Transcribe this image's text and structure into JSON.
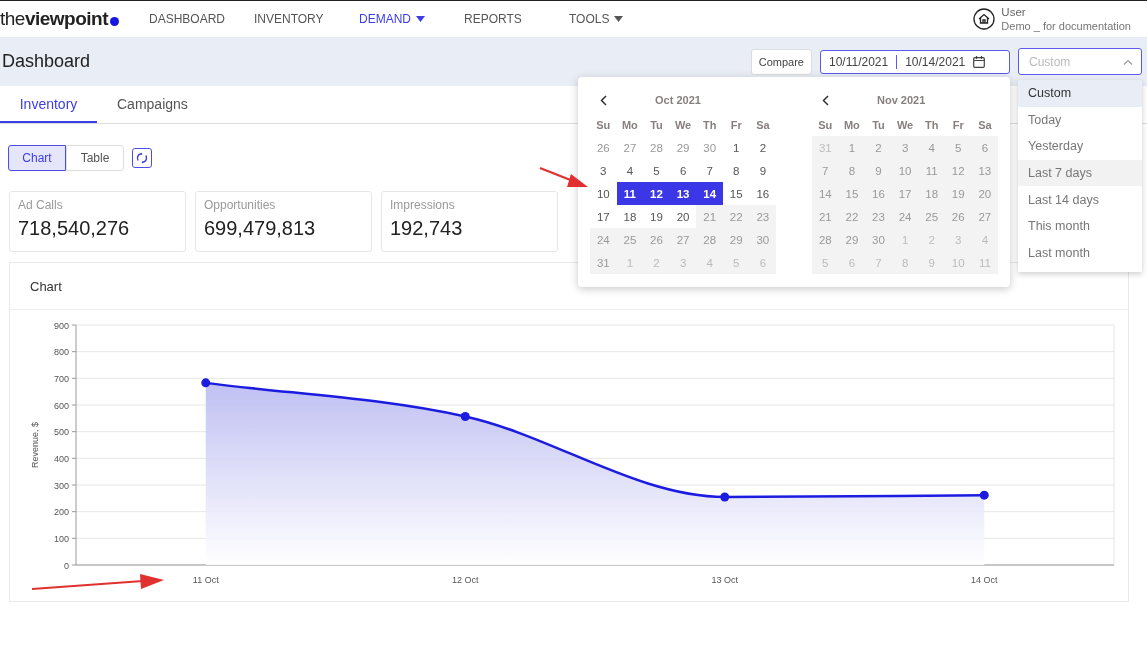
{
  "nav": {
    "logo": "the**viewpoint**",
    "items": [
      {
        "label": "DASHBOARD",
        "selected": false,
        "has_menu": false
      },
      {
        "label": "INVENTORY",
        "selected": false,
        "has_menu": false
      },
      {
        "label": "DEMAND",
        "selected": true,
        "has_menu": true
      },
      {
        "label": "REPORTS",
        "selected": false,
        "has_menu": false
      },
      {
        "label": "TOOLS",
        "selected": false,
        "has_menu": true
      }
    ],
    "user": {
      "name": "User",
      "account": "Demo _ for documentation"
    }
  },
  "header": {
    "title": "Dashboard",
    "compare": "Compare",
    "date_from": "10/11/2021",
    "date_to": "10/14/2021",
    "range_select": {
      "placeholder": "Custom",
      "expanded": true
    }
  },
  "tabs": [
    {
      "label": "Inventory",
      "selected": true
    },
    {
      "label": "Campaigns",
      "selected": false
    }
  ],
  "view_toggle": [
    {
      "label": "Chart",
      "selected": true
    },
    {
      "label": "Table",
      "selected": false
    }
  ],
  "stats": [
    {
      "label": "Ad Calls",
      "value": "718,540,276"
    },
    {
      "label": "Opportunities",
      "value": "699,479,813"
    },
    {
      "label": "Impressions",
      "value": "192,743"
    }
  ],
  "chart_card": {
    "title": "Chart",
    "chart_data": {
      "type": "area",
      "ylabel": "Revenue, $",
      "categories": [
        "11 Oct",
        "12 Oct",
        "13 Oct",
        "14 Oct"
      ],
      "series": [
        {
          "color": "#1c1ce0",
          "values": [
            683,
            557,
            255,
            262
          ]
        }
      ],
      "grid": true,
      "ylim": [
        0,
        900
      ],
      "yticks": [
        0,
        100,
        200,
        300,
        400,
        500,
        600,
        700,
        800,
        900
      ]
    }
  },
  "calendar": {
    "months": [
      {
        "title": "Oct 2021",
        "weekdays": [
          "Su",
          "Mo",
          "Tu",
          "We",
          "Th",
          "Fr",
          "Sa"
        ],
        "weeks": [
          [
            {
              "day": "26",
              "outside": true,
              "disabled": false,
              "selected": false
            },
            {
              "day": "27",
              "outside": true,
              "disabled": false,
              "selected": false
            },
            {
              "day": "28",
              "outside": true,
              "disabled": false,
              "selected": false
            },
            {
              "day": "29",
              "outside": true,
              "disabled": false,
              "selected": false
            },
            {
              "day": "30",
              "outside": true,
              "disabled": false,
              "selected": false
            },
            {
              "day": "1",
              "outside": false,
              "disabled": false,
              "selected": false
            },
            {
              "day": "2",
              "outside": false,
              "disabled": false,
              "selected": false
            }
          ],
          [
            {
              "day": "3",
              "outside": false,
              "disabled": false,
              "selected": false
            },
            {
              "day": "4",
              "outside": false,
              "disabled": false,
              "selected": false
            },
            {
              "day": "5",
              "outside": false,
              "disabled": false,
              "selected": false
            },
            {
              "day": "6",
              "outside": false,
              "disabled": false,
              "selected": false
            },
            {
              "day": "7",
              "outside": false,
              "disabled": false,
              "selected": false
            },
            {
              "day": "8",
              "outside": false,
              "disabled": false,
              "selected": false
            },
            {
              "day": "9",
              "outside": false,
              "disabled": false,
              "selected": false
            }
          ],
          [
            {
              "day": "10",
              "outside": false,
              "disabled": false,
              "selected": false
            },
            {
              "day": "11",
              "outside": false,
              "disabled": false,
              "selected": true
            },
            {
              "day": "12",
              "outside": false,
              "disabled": false,
              "selected": true
            },
            {
              "day": "13",
              "outside": false,
              "disabled": false,
              "selected": true
            },
            {
              "day": "14",
              "outside": false,
              "disabled": false,
              "selected": true
            },
            {
              "day": "15",
              "outside": false,
              "disabled": false,
              "selected": false
            },
            {
              "day": "16",
              "outside": false,
              "disabled": false,
              "selected": false
            }
          ],
          [
            {
              "day": "17",
              "outside": false,
              "disabled": false,
              "selected": false
            },
            {
              "day": "18",
              "outside": false,
              "disabled": false,
              "selected": false
            },
            {
              "day": "19",
              "outside": false,
              "disabled": false,
              "selected": false
            },
            {
              "day": "20",
              "outside": false,
              "disabled": false,
              "selected": false
            },
            {
              "day": "21",
              "outside": false,
              "disabled": true,
              "selected": false
            },
            {
              "day": "22",
              "outside": false,
              "disabled": true,
              "selected": false
            },
            {
              "day": "23",
              "outside": false,
              "disabled": true,
              "selected": false
            }
          ],
          [
            {
              "day": "24",
              "outside": false,
              "disabled": true,
              "selected": false
            },
            {
              "day": "25",
              "outside": false,
              "disabled": true,
              "selected": false
            },
            {
              "day": "26",
              "outside": false,
              "disabled": true,
              "selected": false
            },
            {
              "day": "27",
              "outside": false,
              "disabled": true,
              "selected": false
            },
            {
              "day": "28",
              "outside": false,
              "disabled": true,
              "selected": false
            },
            {
              "day": "29",
              "outside": false,
              "disabled": true,
              "selected": false
            },
            {
              "day": "30",
              "outside": false,
              "disabled": true,
              "selected": false
            }
          ],
          [
            {
              "day": "31",
              "outside": false,
              "disabled": true,
              "selected": false
            },
            {
              "day": "1",
              "outside": true,
              "disabled": true,
              "selected": false
            },
            {
              "day": "2",
              "outside": true,
              "disabled": true,
              "selected": false
            },
            {
              "day": "3",
              "outside": true,
              "disabled": true,
              "selected": false
            },
            {
              "day": "4",
              "outside": true,
              "disabled": true,
              "selected": false
            },
            {
              "day": "5",
              "outside": true,
              "disabled": true,
              "selected": false
            },
            {
              "day": "6",
              "outside": true,
              "disabled": true,
              "selected": false
            }
          ]
        ]
      },
      {
        "title": "Nov 2021",
        "weekdays": [
          "Su",
          "Mo",
          "Tu",
          "We",
          "Th",
          "Fr",
          "Sa"
        ],
        "weeks": [
          [
            {
              "day": "31",
              "outside": true,
              "disabled": true,
              "selected": false
            },
            {
              "day": "1",
              "outside": false,
              "disabled": true,
              "selected": false
            },
            {
              "day": "2",
              "outside": false,
              "disabled": true,
              "selected": false
            },
            {
              "day": "3",
              "outside": false,
              "disabled": true,
              "selected": false
            },
            {
              "day": "4",
              "outside": false,
              "disabled": true,
              "selected": false
            },
            {
              "day": "5",
              "outside": false,
              "disabled": true,
              "selected": false
            },
            {
              "day": "6",
              "outside": false,
              "disabled": true,
              "selected": false
            }
          ],
          [
            {
              "day": "7",
              "outside": false,
              "disabled": true,
              "selected": false
            },
            {
              "day": "8",
              "outside": false,
              "disabled": true,
              "selected": false
            },
            {
              "day": "9",
              "outside": false,
              "disabled": true,
              "selected": false
            },
            {
              "day": "10",
              "outside": false,
              "disabled": true,
              "selected": false
            },
            {
              "day": "11",
              "outside": false,
              "disabled": true,
              "selected": false
            },
            {
              "day": "12",
              "outside": false,
              "disabled": true,
              "selected": false
            },
            {
              "day": "13",
              "outside": false,
              "disabled": true,
              "selected": false
            }
          ],
          [
            {
              "day": "14",
              "outside": false,
              "disabled": true,
              "selected": false
            },
            {
              "day": "15",
              "outside": false,
              "disabled": true,
              "selected": false
            },
            {
              "day": "16",
              "outside": false,
              "disabled": true,
              "selected": false
            },
            {
              "day": "17",
              "outside": false,
              "disabled": true,
              "selected": false
            },
            {
              "day": "18",
              "outside": false,
              "disabled": true,
              "selected": false
            },
            {
              "day": "19",
              "outside": false,
              "disabled": true,
              "selected": false
            },
            {
              "day": "20",
              "outside": false,
              "disabled": true,
              "selected": false
            }
          ],
          [
            {
              "day": "21",
              "outside": false,
              "disabled": true,
              "selected": false
            },
            {
              "day": "22",
              "outside": false,
              "disabled": true,
              "selected": false
            },
            {
              "day": "23",
              "outside": false,
              "disabled": true,
              "selected": false
            },
            {
              "day": "24",
              "outside": false,
              "disabled": true,
              "selected": false
            },
            {
              "day": "25",
              "outside": false,
              "disabled": true,
              "selected": false
            },
            {
              "day": "26",
              "outside": false,
              "disabled": true,
              "selected": false
            },
            {
              "day": "27",
              "outside": false,
              "disabled": true,
              "selected": false
            }
          ],
          [
            {
              "day": "28",
              "outside": false,
              "disabled": true,
              "selected": false
            },
            {
              "day": "29",
              "outside": false,
              "disabled": true,
              "selected": false
            },
            {
              "day": "30",
              "outside": false,
              "disabled": true,
              "selected": false
            },
            {
              "day": "1",
              "outside": true,
              "disabled": true,
              "selected": false
            },
            {
              "day": "2",
              "outside": true,
              "disabled": true,
              "selected": false
            },
            {
              "day": "3",
              "outside": true,
              "disabled": true,
              "selected": false
            },
            {
              "day": "4",
              "outside": true,
              "disabled": true,
              "selected": false
            }
          ],
          [
            {
              "day": "5",
              "outside": true,
              "disabled": true,
              "selected": false
            },
            {
              "day": "6",
              "outside": true,
              "disabled": true,
              "selected": false
            },
            {
              "day": "7",
              "outside": true,
              "disabled": true,
              "selected": false
            },
            {
              "day": "8",
              "outside": true,
              "disabled": true,
              "selected": false
            },
            {
              "day": "9",
              "outside": true,
              "disabled": true,
              "selected": false
            },
            {
              "day": "10",
              "outside": true,
              "disabled": true,
              "selected": false
            },
            {
              "day": "11",
              "outside": true,
              "disabled": true,
              "selected": false
            }
          ]
        ]
      }
    ]
  },
  "range_options": [
    {
      "label": "Custom",
      "selected": true,
      "hovered": false
    },
    {
      "label": "Today",
      "selected": false,
      "hovered": false
    },
    {
      "label": "Yesterday",
      "selected": false,
      "hovered": false
    },
    {
      "label": "Last 7 days",
      "selected": false,
      "hovered": true
    },
    {
      "label": "Last 14 days",
      "selected": false,
      "hovered": false
    },
    {
      "label": "This month",
      "selected": false,
      "hovered": false
    },
    {
      "label": "Last month",
      "selected": false,
      "hovered": false
    }
  ]
}
